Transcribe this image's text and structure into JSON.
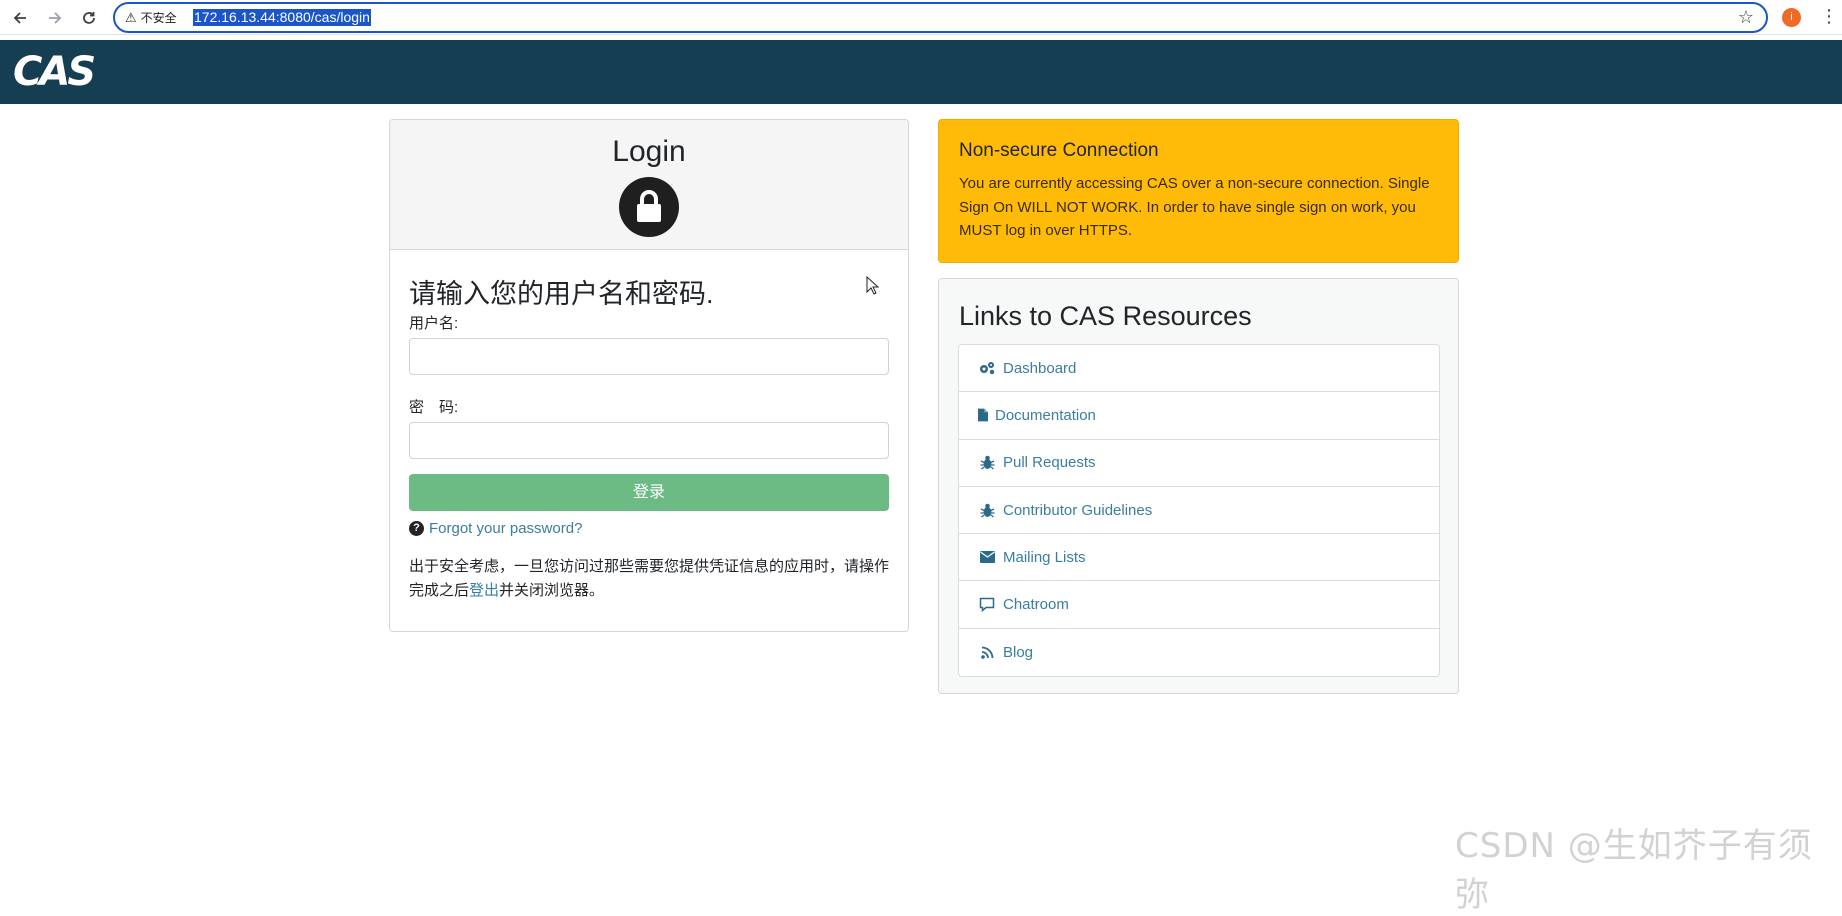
{
  "browser": {
    "back_icon": "arrow-left-icon",
    "forward_icon": "arrow-right-icon",
    "reload_icon": "reload-icon",
    "security_label": "不安全",
    "url": "172.16.13.44:8080/cas/login",
    "profile_initial": "i"
  },
  "header": {
    "logo_text": "CAS"
  },
  "login": {
    "title": "Login",
    "prompt": "请输入您的用户名和密码.",
    "username_label": "用户名:",
    "username_value": "",
    "password_label": "密　码:",
    "password_value": "",
    "submit_label": "登录",
    "forgot_label": "Forgot your password?",
    "notice_before": "出于安全考虑，一旦您访问过那些需要您提供凭证信息的应用时，请操作完成之后",
    "notice_link": "登出",
    "notice_after": "并关闭浏览器。"
  },
  "warning": {
    "title": "Non-secure Connection",
    "text": "You are currently accessing CAS over a non-secure connection. Single Sign On WILL NOT WORK. In order to have single sign on work, you MUST log in over HTTPS.",
    "bg_color": "#ffbb08"
  },
  "resources": {
    "title": "Links to CAS Resources",
    "items": [
      {
        "label": "Dashboard",
        "icon": "gears-icon"
      },
      {
        "label": "Documentation",
        "icon": "file-icon"
      },
      {
        "label": "Pull Requests",
        "icon": "bug-icon"
      },
      {
        "label": "Contributor Guidelines",
        "icon": "bug-icon"
      },
      {
        "label": "Mailing Lists",
        "icon": "envelope-icon"
      },
      {
        "label": "Chatroom",
        "icon": "comment-icon"
      },
      {
        "label": "Blog",
        "icon": "rss-icon"
      }
    ]
  },
  "watermark": "CSDN @生如芥子有须弥",
  "colors": {
    "header_bg": "#153e52",
    "button_bg": "#6cba84",
    "link": "#3a7ea1"
  }
}
